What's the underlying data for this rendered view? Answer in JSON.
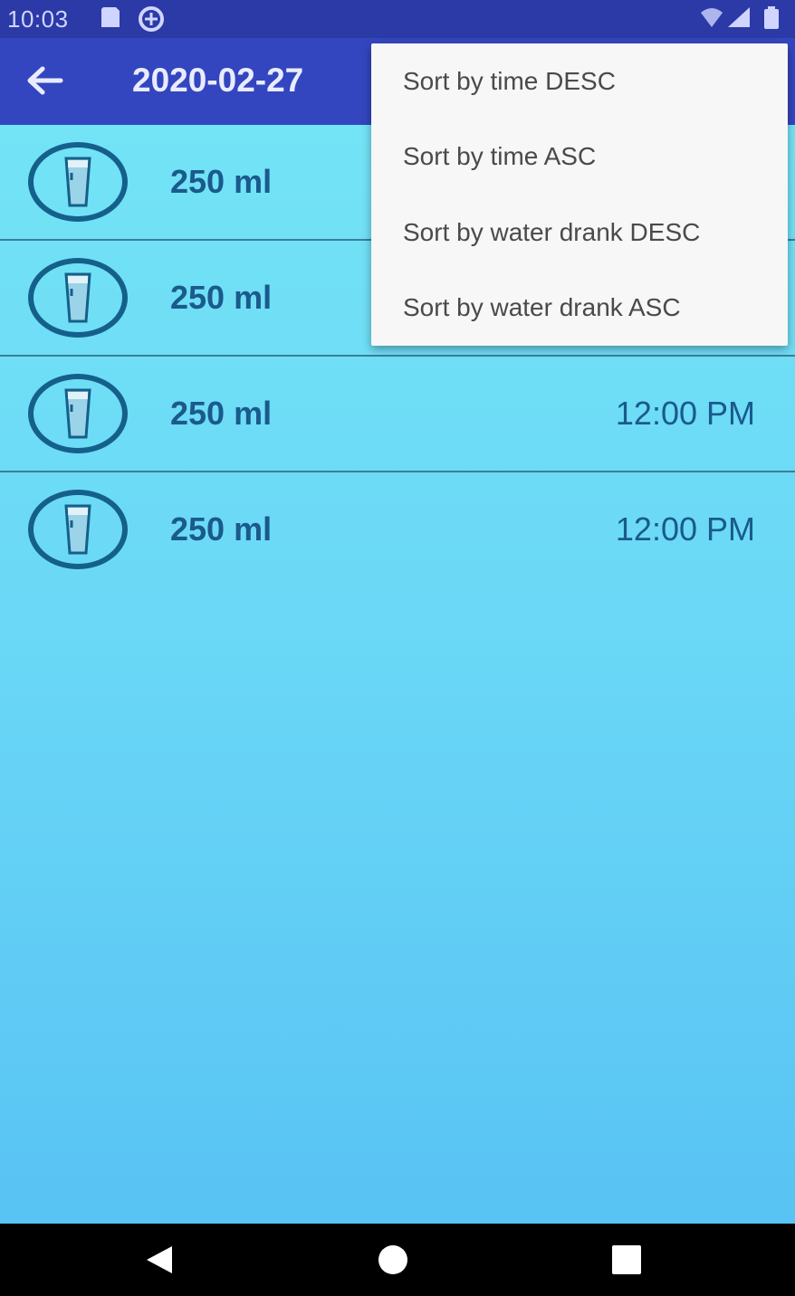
{
  "status_bar": {
    "time": "10:03"
  },
  "app_bar": {
    "title": "2020-02-27",
    "back_icon": "arrow-left-icon"
  },
  "entries": [
    {
      "amount": "250 ml",
      "time": "",
      "icon": "water-glass-icon"
    },
    {
      "amount": "250 ml",
      "time": "",
      "icon": "water-glass-icon"
    },
    {
      "amount": "250 ml",
      "time": "12:00 PM",
      "icon": "water-glass-icon"
    },
    {
      "amount": "250 ml",
      "time": "12:00 PM",
      "icon": "water-glass-icon"
    }
  ],
  "sort_menu": {
    "items": [
      "Sort by time DESC",
      "Sort by time ASC",
      "Sort by water drank DESC",
      "Sort by water drank ASC"
    ]
  },
  "colors": {
    "status_bar": "#2b3aa6",
    "app_bar": "#3346bf",
    "content_top": "#73e3f6",
    "content_bottom": "#58c3f4",
    "text_accent": "#1a5a8c"
  }
}
